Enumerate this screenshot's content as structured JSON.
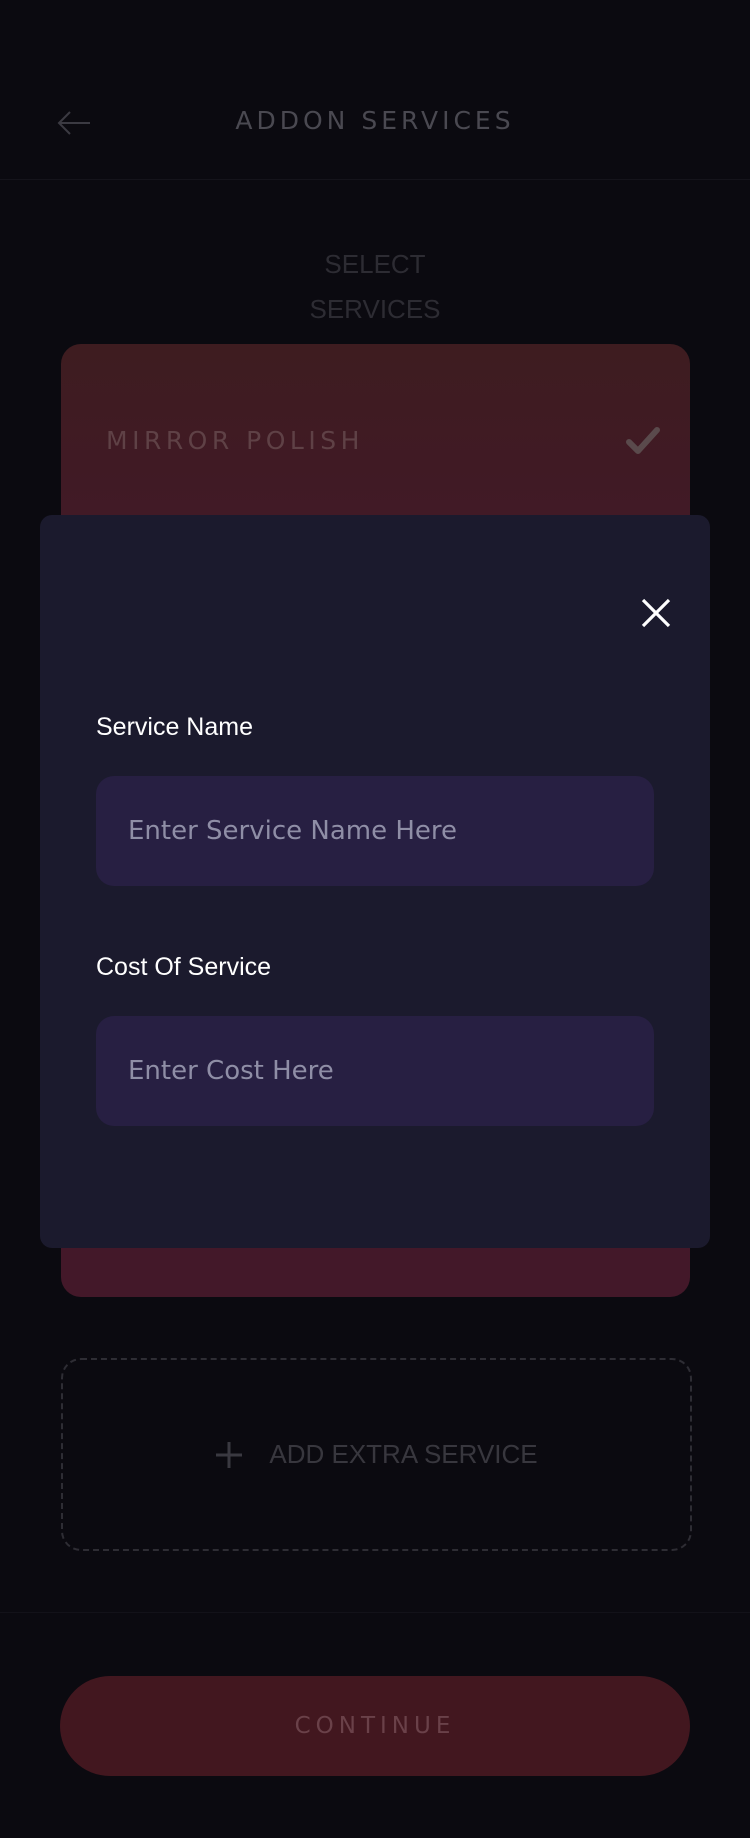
{
  "header": {
    "title": "ADDON SERVICES",
    "back_icon": "arrow-left-icon"
  },
  "section": {
    "title_line1": "SELECT",
    "title_line2": "SERVICES"
  },
  "service_card": {
    "label": "MIRROR POLISH",
    "selected": true,
    "check_icon": "checkmark-icon"
  },
  "add_extra": {
    "label": "ADD EXTRA SERVICE",
    "icon": "plus-icon"
  },
  "continue_button": {
    "label": "CONTINUE"
  },
  "modal": {
    "close_icon": "close-icon",
    "service_name": {
      "label": "Service Name",
      "placeholder": "Enter Service Name Here",
      "value": ""
    },
    "cost": {
      "label": "Cost Of Service",
      "placeholder": "Enter Cost Here",
      "value": ""
    }
  },
  "colors": {
    "background": "#0b0a10",
    "modal_background": "#1b1a2d",
    "input_background": "#271f42",
    "card_accent": "#43182a",
    "placeholder": "#8f8ea6"
  }
}
